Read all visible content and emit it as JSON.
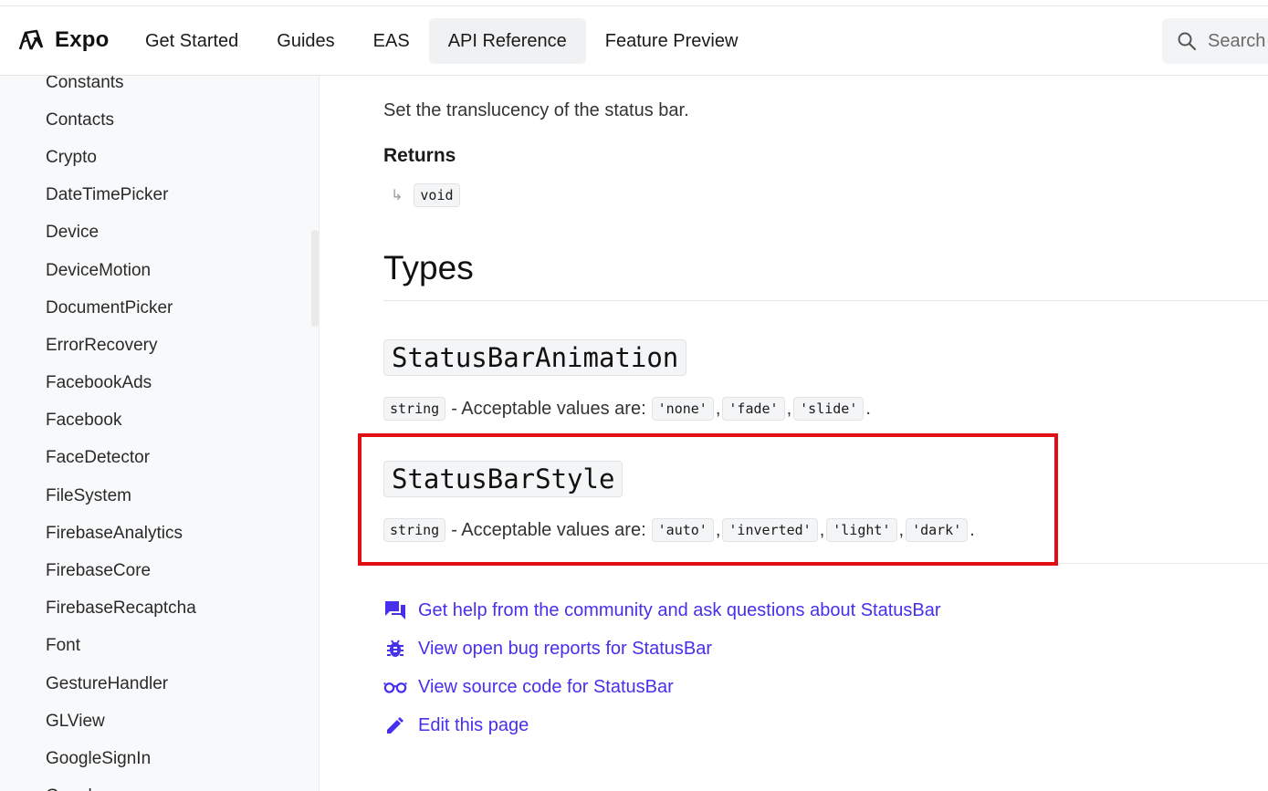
{
  "header": {
    "brand": "Expo",
    "nav": [
      "Get Started",
      "Guides",
      "EAS",
      "API Reference",
      "Feature Preview"
    ],
    "active_nav": "API Reference",
    "search_placeholder": "Search"
  },
  "sidebar": {
    "items": [
      "Constants",
      "Contacts",
      "Crypto",
      "DateTimePicker",
      "Device",
      "DeviceMotion",
      "DocumentPicker",
      "ErrorRecovery",
      "FacebookAds",
      "Facebook",
      "FaceDetector",
      "FileSystem",
      "FirebaseAnalytics",
      "FirebaseCore",
      "FirebaseRecaptcha",
      "Font",
      "GestureHandler",
      "GLView",
      "GoogleSignIn",
      "Google"
    ]
  },
  "main": {
    "description": "Set the translucency of the status bar.",
    "returns_heading": "Returns",
    "returns_arrow": "↳",
    "returns_type": "void",
    "types_heading": "Types",
    "types": [
      {
        "name": "StatusBarAnimation",
        "base": "string",
        "text": "- Acceptable values are:",
        "values": [
          "'none'",
          "'fade'",
          "'slide'"
        ]
      },
      {
        "name": "StatusBarStyle",
        "base": "string",
        "text": "- Acceptable values are:",
        "values": [
          "'auto'",
          "'inverted'",
          "'light'",
          "'dark'"
        ]
      }
    ],
    "comma": ",",
    "period": ".",
    "links": [
      {
        "icon": "chat-icon",
        "label": "Get help from the community and ask questions about StatusBar"
      },
      {
        "icon": "bug-icon",
        "label": "View open bug reports for StatusBar"
      },
      {
        "icon": "glasses-icon",
        "label": "View source code for StatusBar"
      },
      {
        "icon": "pencil-icon",
        "label": "Edit this page"
      }
    ]
  },
  "colors": {
    "link": "#4630eb",
    "highlight": "#e30d14",
    "sidebar_bg": "#f8f9fa"
  }
}
